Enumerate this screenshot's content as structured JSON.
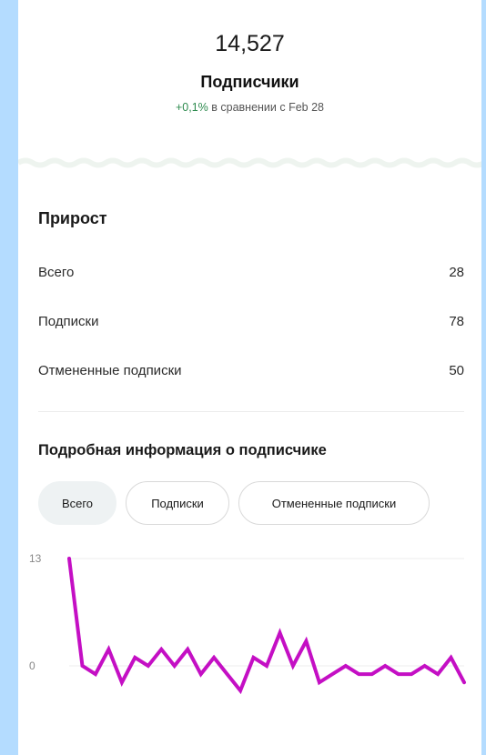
{
  "summary": {
    "total": "14,527",
    "label": "Подписчики",
    "change_pct": "+0,1%",
    "change_text": "в сравнении с Feb 28"
  },
  "growth": {
    "title": "Прирост",
    "rows": [
      {
        "label": "Всего",
        "value": "28"
      },
      {
        "label": "Подписки",
        "value": "78"
      },
      {
        "label": "Отмененные подписки",
        "value": "50"
      }
    ]
  },
  "details": {
    "title": "Подробная информация о подписчике",
    "filters": [
      {
        "label": "Всего",
        "active": true
      },
      {
        "label": "Подписки",
        "active": false
      },
      {
        "label": "Отмененные подписки",
        "active": false
      }
    ]
  },
  "chart_data": {
    "type": "line",
    "y_ticks": [
      "13",
      "0"
    ],
    "ylim": [
      -3,
      13
    ],
    "series": [
      {
        "color": "#c40fc4",
        "values": [
          13,
          0,
          -1,
          2,
          -2,
          1,
          0,
          2,
          0,
          2,
          -1,
          1,
          -1,
          -3,
          1,
          0,
          4,
          0,
          3,
          -2,
          -1,
          0,
          -1,
          -1,
          0,
          -1,
          -1,
          0,
          -1,
          1,
          -2
        ]
      }
    ],
    "grid": true,
    "legend": "none"
  },
  "colors": {
    "background": "#b4dcff",
    "positive": "#2d8a4e",
    "line": "#c40fc4"
  }
}
